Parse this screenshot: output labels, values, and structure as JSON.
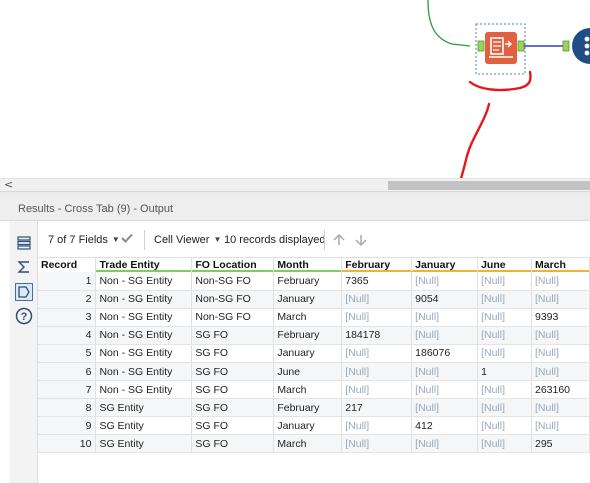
{
  "results": {
    "title": "Results - Cross Tab (9) - Output",
    "toolbar": {
      "fields_label": "7 of 7 Fields",
      "viewer_label": "Cell Viewer",
      "records_label": "10 records displayed"
    }
  },
  "rail": {
    "icons": [
      "table-icon",
      "sum-icon",
      "tag-icon",
      "help-icon"
    ]
  },
  "scrollbar": {
    "left_arrow": "<"
  },
  "table": {
    "columns": [
      {
        "label": "Record",
        "color": ""
      },
      {
        "label": "Trade Entity",
        "color": "#7ccf5b"
      },
      {
        "label": "FO Location",
        "color": "#7ccf5b"
      },
      {
        "label": "Month",
        "color": "#7ccf5b"
      },
      {
        "label": "February",
        "color": "#f2b134"
      },
      {
        "label": "January",
        "color": "#f2b134"
      },
      {
        "label": "June",
        "color": "#f2b134"
      },
      {
        "label": "March",
        "color": "#f2b134"
      }
    ],
    "rows": [
      [
        "1",
        "Non - SG Entity",
        "Non-SG FO",
        "February",
        "7365",
        "[Null]",
        "[Null]",
        "[Null]"
      ],
      [
        "2",
        "Non - SG Entity",
        "Non-SG FO",
        "January",
        "[Null]",
        "9054",
        "[Null]",
        "[Null]"
      ],
      [
        "3",
        "Non - SG Entity",
        "Non-SG FO",
        "March",
        "[Null]",
        "[Null]",
        "[Null]",
        "9393"
      ],
      [
        "4",
        "Non - SG Entity",
        "SG FO",
        "February",
        "184178",
        "[Null]",
        "[Null]",
        "[Null]"
      ],
      [
        "5",
        "Non - SG Entity",
        "SG FO",
        "January",
        "[Null]",
        "186076",
        "[Null]",
        "[Null]"
      ],
      [
        "6",
        "Non - SG Entity",
        "SG FO",
        "June",
        "[Null]",
        "[Null]",
        "1",
        "[Null]"
      ],
      [
        "7",
        "Non - SG Entity",
        "SG FO",
        "March",
        "[Null]",
        "[Null]",
        "[Null]",
        "263160"
      ],
      [
        "8",
        "SG Entity",
        "SG FO",
        "February",
        "217",
        "[Null]",
        "[Null]",
        "[Null]"
      ],
      [
        "9",
        "SG Entity",
        "SG FO",
        "January",
        "[Null]",
        "412",
        "[Null]",
        "[Null]"
      ],
      [
        "10",
        "SG Entity",
        "SG FO",
        "March",
        "[Null]",
        "[Null]",
        "[Null]",
        "295"
      ]
    ]
  },
  "colors": {
    "tool_orange": "#e0603f",
    "annotation_red": "#e41818",
    "connector_green": "#2e9a3a",
    "connector_blue": "#2d3fbf",
    "browse_blue": "#1f4e86"
  }
}
